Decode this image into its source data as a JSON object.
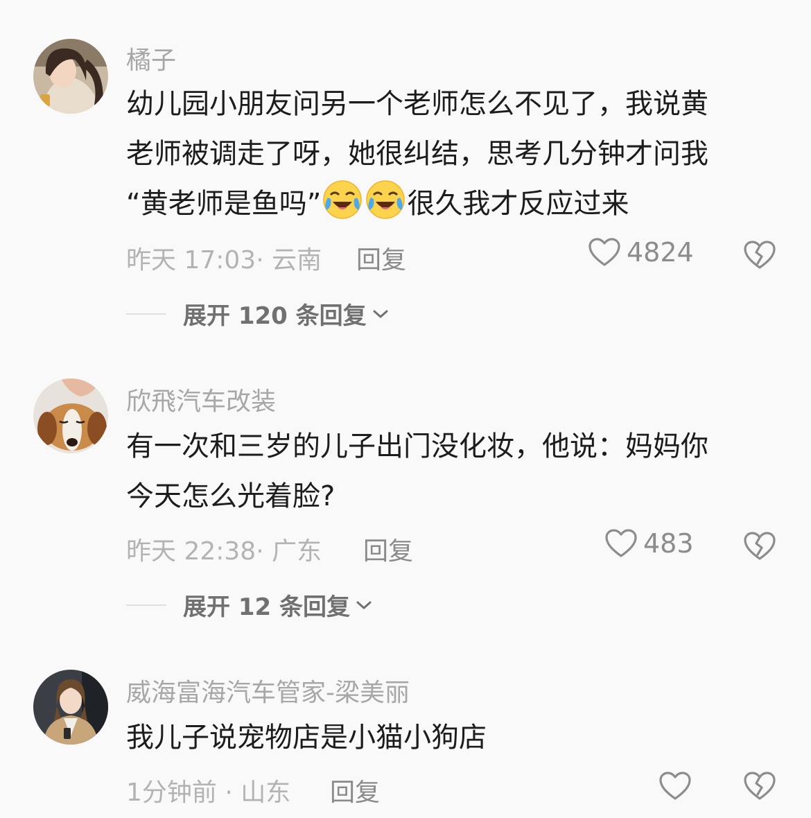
{
  "comments": [
    {
      "username": "橘子",
      "content_lines": [
        "幼儿园小朋友问另一个老师怎么不见了，我说黄",
        "老师被调走了呀，她很纠结，思考几分钟才问我"
      ],
      "content_line3_pre": "“黄老师是鱼吗”",
      "content_line3_post": "很久我才反应过来",
      "inline_emoji": "crying-laughing-emoji",
      "meta": "昨天 17:03· 云南",
      "reply_label": "回复",
      "like_count": "4824",
      "expand_label": "展开 120 条回复"
    },
    {
      "username": "欣飛汽车改装",
      "content_lines": [
        "有一次和三岁的儿子出门没化妆，他说：妈妈你",
        "今天怎么光着脸?"
      ],
      "meta": "昨天 22:38· 广东",
      "reply_label": "回复",
      "like_count": "483",
      "expand_label": "展开 12 条回复"
    },
    {
      "username": "威海富海汽车管家-梁美丽",
      "content_lines": [
        "我儿子说宠物店是小猫小狗店"
      ],
      "meta": "1分钟前 · 山东",
      "reply_label": "回复",
      "like_count": ""
    }
  ],
  "icons": {
    "like": "heart-outline-icon",
    "dislike": "broken-heart-icon",
    "expand": "chevron-down-icon"
  },
  "colors": {
    "background": "#f9f9f9",
    "username": "#a7a7a7",
    "content": "#1c1c1c",
    "meta": "#b3b3b3",
    "action": "#8c8c8c"
  }
}
